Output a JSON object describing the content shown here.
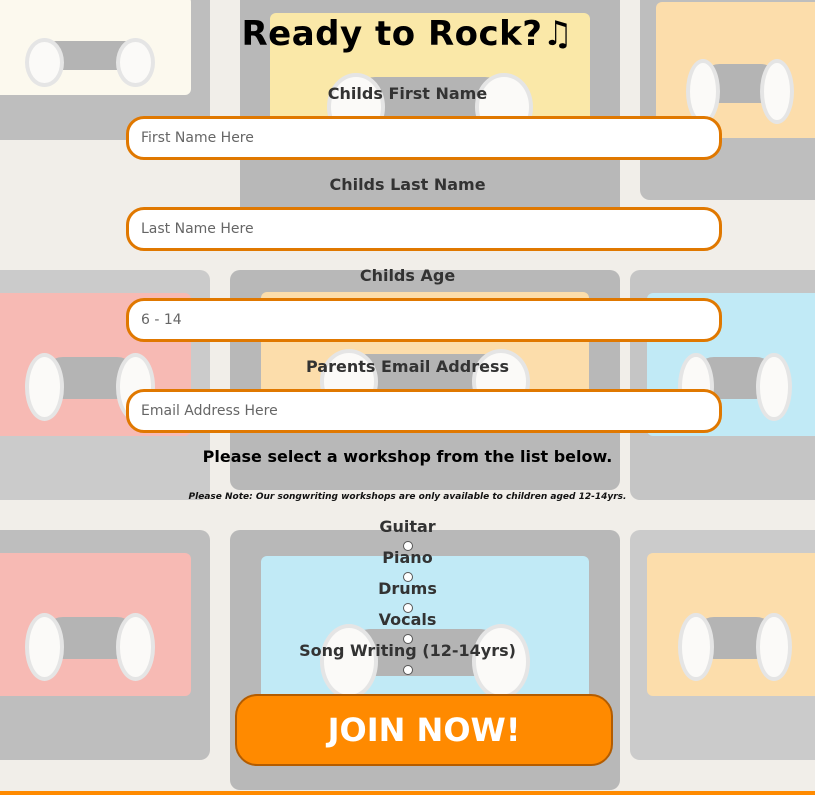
{
  "form": {
    "title": "Ready to Rock?",
    "title_icon": "music-note-icon",
    "first_name": {
      "label": "Childs First Name",
      "placeholder": "First Name Here",
      "value": ""
    },
    "last_name": {
      "label": "Childs Last Name",
      "placeholder": "Last Name Here",
      "value": ""
    },
    "age": {
      "label": "Childs Age",
      "placeholder": "6 - 14",
      "value": ""
    },
    "email": {
      "label": "Parents Email Address",
      "placeholder": "Email Address Here",
      "value": ""
    },
    "workshop_prompt": "Please select a workshop from the list below.",
    "note": "Please Note: Our songwriting workshops are only available to children aged 12-14yrs.",
    "workshops": [
      "Guitar",
      "Piano",
      "Drums",
      "Vocals",
      "Song Writing (12-14yrs)"
    ],
    "submit_label": "JOIN NOW!"
  },
  "colors": {
    "accent": "#ff8a00",
    "input_border": "#e07800",
    "cassette_colors": [
      "#f2c21b",
      "#e94b3c",
      "#5cc7e8",
      "#f6a623",
      "#f6f0d2"
    ]
  }
}
